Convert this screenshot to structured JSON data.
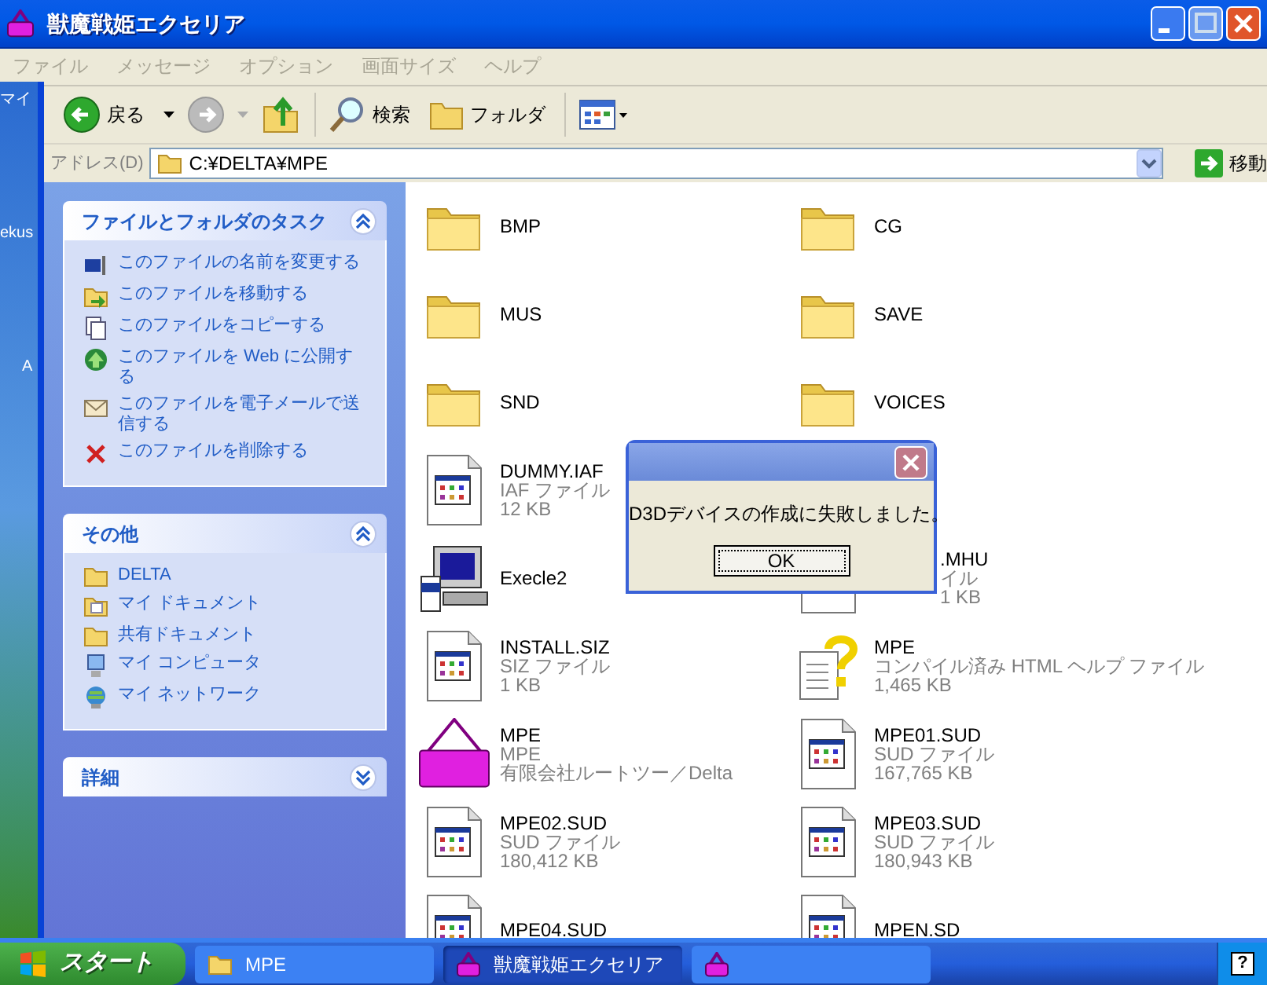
{
  "window": {
    "title": "獣魔戦姫エクセリア"
  },
  "menu": [
    {
      "label": "ファイル",
      "disabled": true
    },
    {
      "label": "メッセージ",
      "disabled": true
    },
    {
      "label": "オプション",
      "disabled": true
    },
    {
      "label": "画面サイズ",
      "disabled": true
    },
    {
      "label": "ヘルプ",
      "disabled": true
    }
  ],
  "desktop_labels": [
    "マイ",
    "ekus",
    "A"
  ],
  "toolbar": {
    "back": "戻る",
    "search": "検索",
    "folders": "フォルダ"
  },
  "address": {
    "label": "アドレス(D)",
    "value": "C:¥DELTA¥MPE",
    "go": "移動"
  },
  "panels": [
    {
      "title": "ファイルとフォルダのタスク",
      "expanded": true,
      "items": [
        {
          "kind": "rename",
          "label": "このファイルの名前を変更する"
        },
        {
          "kind": "move",
          "label": "このファイルを移動する"
        },
        {
          "kind": "copy",
          "label": "このファイルをコピーする"
        },
        {
          "kind": "web",
          "label": "このファイルを Web に公開する"
        },
        {
          "kind": "mail",
          "label": "このファイルを電子メールで送信する"
        },
        {
          "kind": "delete",
          "label": "このファイルを削除する"
        }
      ]
    },
    {
      "title": "その他",
      "expanded": true,
      "items": [
        {
          "kind": "folder",
          "label": "DELTA"
        },
        {
          "kind": "docs",
          "label": "マイ ドキュメント"
        },
        {
          "kind": "folder",
          "label": "共有ドキュメント"
        },
        {
          "kind": "computer",
          "label": "マイ コンピュータ"
        },
        {
          "kind": "network",
          "label": "マイ ネットワーク"
        }
      ]
    },
    {
      "title": "詳細",
      "expanded": false
    }
  ],
  "file_columns": [
    [
      {
        "kind": "folder",
        "name": "BMP"
      },
      {
        "kind": "folder",
        "name": "MUS"
      },
      {
        "kind": "folder",
        "name": "SND"
      },
      {
        "kind": "doc",
        "name": "DUMMY.IAF",
        "type": "IAF ファイル",
        "size": "12 KB"
      },
      {
        "kind": "setup",
        "name": "Execle2"
      },
      {
        "kind": "doc",
        "name": "INSTALL.SIZ",
        "type": "SIZ ファイル",
        "size": "1 KB"
      },
      {
        "kind": "delta",
        "name": "MPE",
        "type": "MPE",
        "size": "有限会社ルートツー／Delta"
      },
      {
        "kind": "doc",
        "name": "MPE02.SUD",
        "type": "SUD ファイル",
        "size": "180,412 KB"
      },
      {
        "kind": "doc",
        "name": "MPE04.SUD"
      }
    ],
    [
      {
        "kind": "folder",
        "name": "CG"
      },
      {
        "kind": "folder",
        "name": "SAVE"
      },
      {
        "kind": "folder",
        "name": "VOICES"
      },
      {
        "kind": "doc",
        "name": ".MHU",
        "type": "イル",
        "size": "1 KB",
        "partly_hidden": true
      },
      {
        "kind": "help",
        "name": "MPE",
        "type": "コンパイル済み HTML ヘルプ ファイル",
        "size": "1,465 KB"
      },
      {
        "kind": "doc",
        "name": "MPE01.SUD",
        "type": "SUD ファイル",
        "size": "167,765 KB"
      },
      {
        "kind": "doc",
        "name": "MPE03.SUD",
        "type": "SUD ファイル",
        "size": "180,943 KB"
      },
      {
        "kind": "doc",
        "name": "MPEN.SD"
      }
    ]
  ],
  "dialog": {
    "message": "D3Dデバイスの作成に失敗しました。",
    "button": "OK"
  },
  "taskbar": {
    "start": "スタート",
    "tasks": [
      {
        "kind": "folder",
        "label": "MPE",
        "selected": false
      },
      {
        "kind": "app",
        "label": "獣魔戦姫エクセリア",
        "selected": true
      },
      {
        "kind": "app",
        "selected": false
      }
    ],
    "tray_icon": "?"
  }
}
